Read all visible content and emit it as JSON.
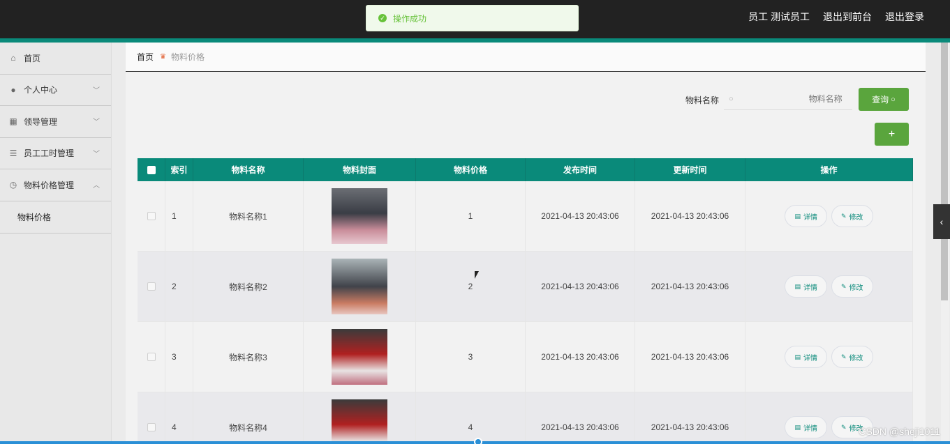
{
  "toast": {
    "message": "操作成功"
  },
  "header": {
    "user": "员工 测试员工",
    "to_front": "退出到前台",
    "logout": "退出登录"
  },
  "sidebar": {
    "items": [
      {
        "label": "首页",
        "icon": "home-icon"
      },
      {
        "label": "个人中心",
        "icon": "user-icon"
      },
      {
        "label": "领导管理",
        "icon": "grid-icon"
      },
      {
        "label": "员工工时管理",
        "icon": "list-icon"
      },
      {
        "label": "物料价格管理",
        "icon": "gauge-icon"
      }
    ],
    "submenu": {
      "label": "物料价格"
    }
  },
  "breadcrumb": {
    "home": "首页",
    "current": "物料价格"
  },
  "search": {
    "label": "物料名称",
    "placeholder": "物料名称",
    "button": "查询"
  },
  "add_button": "+",
  "table": {
    "headers": [
      "索引",
      "物料名称",
      "物料封面",
      "物料价格",
      "发布时间",
      "更新时间",
      "操作"
    ],
    "rows": [
      {
        "index": "1",
        "name": "物料名称1",
        "price": "1",
        "publish": "2021-04-13 20:43:06",
        "update": "2021-04-13 20:43:06"
      },
      {
        "index": "2",
        "name": "物料名称2",
        "price": "2",
        "publish": "2021-04-13 20:43:06",
        "update": "2021-04-13 20:43:06"
      },
      {
        "index": "3",
        "name": "物料名称3",
        "price": "3",
        "publish": "2021-04-13 20:43:06",
        "update": "2021-04-13 20:43:06"
      },
      {
        "index": "4",
        "name": "物料名称4",
        "price": "4",
        "publish": "2021-04-13 20:43:06",
        "update": "2021-04-13 20:43:06"
      }
    ],
    "detail_label": "详情",
    "edit_label": "修改"
  },
  "watermark": "CSDN @sheji1011",
  "colors": {
    "accent": "#0a8a7a",
    "button": "#5aa53d",
    "topbar": "#222222"
  }
}
